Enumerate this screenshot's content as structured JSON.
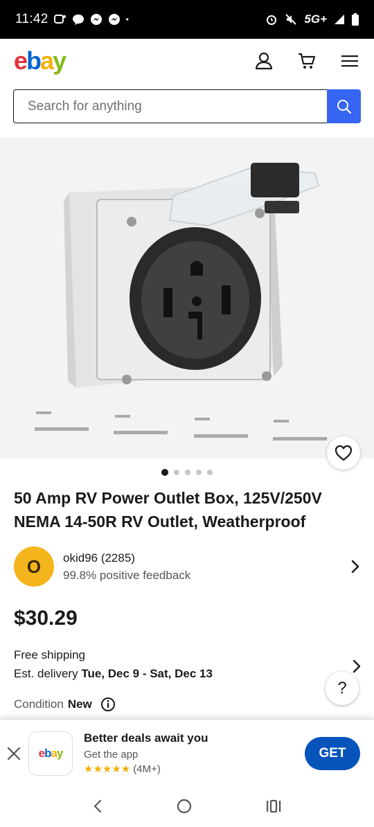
{
  "status_bar": {
    "time": "11:42",
    "network": "5G+",
    "dot": "•"
  },
  "header": {
    "logo": {
      "e": "e",
      "b": "b",
      "a": "a",
      "y": "y"
    }
  },
  "search": {
    "placeholder": "Search for anything"
  },
  "gallery": {
    "image_count": 5,
    "active_index": 0
  },
  "product": {
    "title": "50 Amp RV Power Outlet Box, 125V/250V NEMA 14-50R RV Outlet, Weatherproof",
    "price": "$30.29"
  },
  "seller": {
    "initial": "O",
    "name": "okid96 (2285)",
    "feedback": "99.8% positive feedback"
  },
  "shipping": {
    "free": "Free shipping",
    "est_label": "Est. delivery",
    "est_dates": "Tue, Dec 9 - Sat, Dec 13"
  },
  "condition": {
    "label": "Condition",
    "value": "New"
  },
  "help": {
    "label": "?"
  },
  "app_banner": {
    "logo": {
      "e": "e",
      "b": "b",
      "a": "a",
      "y": "y"
    },
    "headline": "Better deals await you",
    "sub": "Get the app",
    "stars": "★★★★★",
    "rating_count": "(4M+)",
    "get_label": "GET"
  },
  "colors": {
    "accent": "#3665f3",
    "get_button": "#0654ba",
    "star": "#f5af02",
    "avatar": "#f4b51c"
  }
}
